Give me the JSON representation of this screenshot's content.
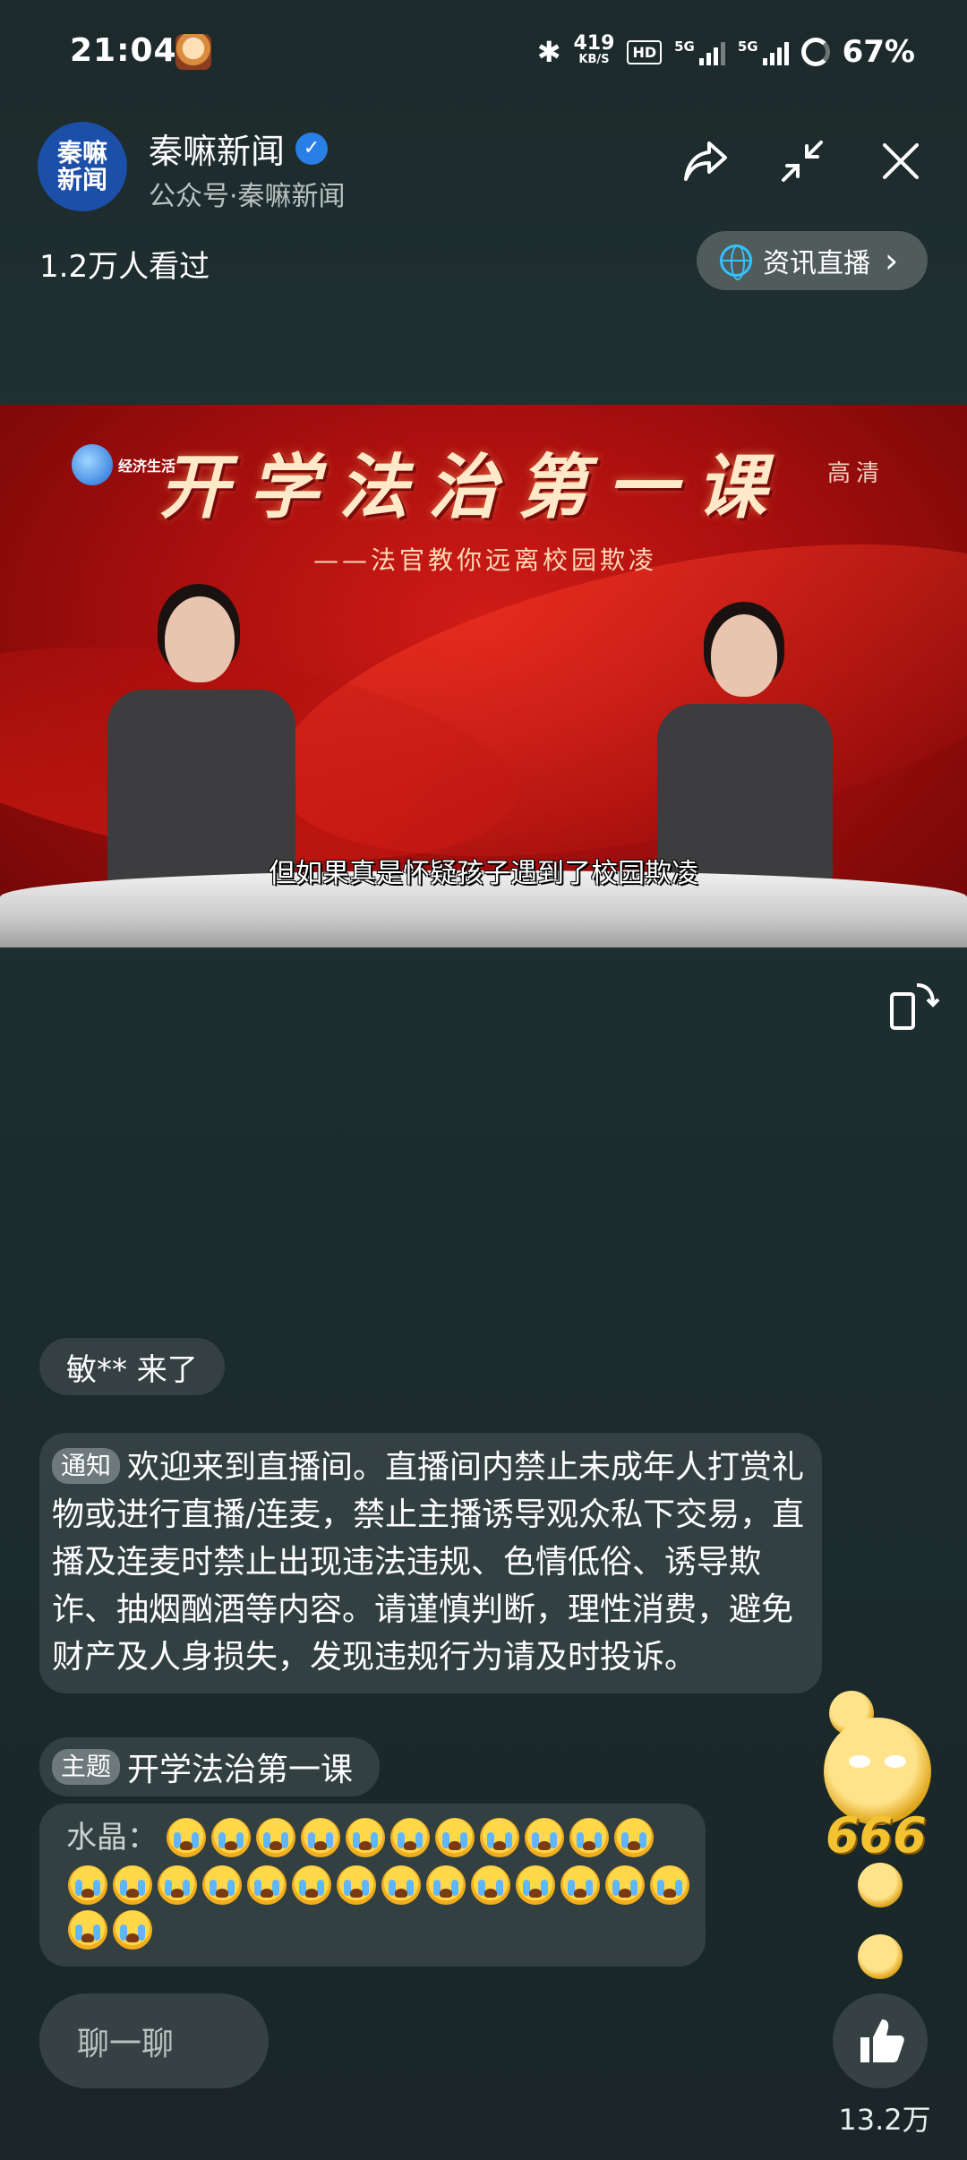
{
  "status_bar": {
    "time": "21:04",
    "net_speed_value": "419",
    "net_speed_unit": "KB/S",
    "hd_badge": "HD",
    "signal1_label": "5G",
    "signal2_label": "5G",
    "battery": "67%",
    "icons": [
      "app-notification-icon",
      "bluetooth-icon",
      "signal-icon",
      "battery-icon"
    ]
  },
  "header": {
    "logo_line1": "秦嘛",
    "logo_line2": "新闻",
    "channel_name": "秦嘛新闻",
    "channel_sub": "公众号·秦嘛新闻",
    "viewers": "1.2万人看过",
    "news_live_label": "资讯直播",
    "chevron": "›",
    "icons": [
      "share-icon",
      "minimize-icon",
      "close-icon",
      "globe-icon",
      "verified-icon"
    ]
  },
  "video": {
    "brand": "经济生活",
    "title": "开学法治第一课",
    "subtitle": "——法官教你远离校园欺凌",
    "quality": "高清",
    "caption": "但如果真是怀疑孩子遇到了校园欺凌"
  },
  "chat": {
    "entry_message": "敏** 来了",
    "notice_tag": "通知",
    "notice_text": "欢迎来到直播间。直播间内禁止未成年人打赏礼物或进行直播/连麦，禁止主播诱导观众私下交易，直播及连麦时禁止出现违法违规、色情低俗、诱导欺诈、抽烟酗酒等内容。请谨慎判断，理性消费，避免财产及人身损失，发现违规行为请及时投诉。",
    "topic_tag": "主题",
    "topic_text": "开学法治第一课",
    "emoji_user": "水晶：",
    "emoji_name": "crying-face-emoji",
    "emoji_count": 27
  },
  "bottom": {
    "chat_placeholder": "聊一聊",
    "sticker_text": "666",
    "like_count": "13.2万",
    "colors": {
      "accent_blue": "#2a7fe6",
      "video_red": "#c8140f"
    }
  }
}
